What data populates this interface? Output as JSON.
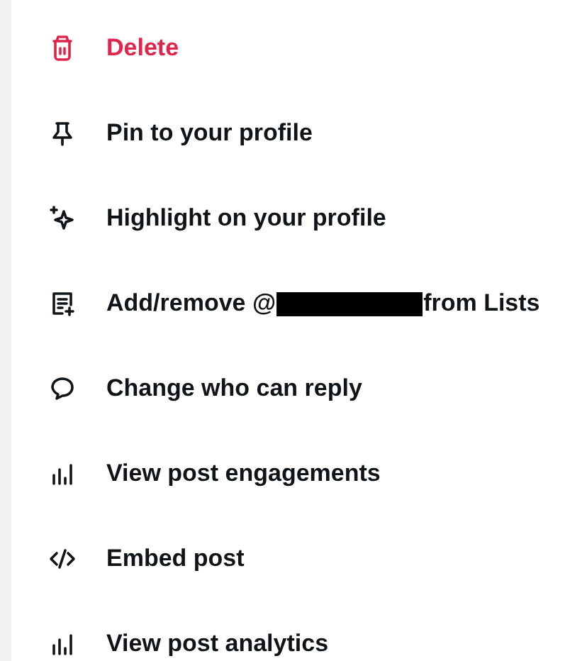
{
  "menu": {
    "items": [
      {
        "kind": "danger",
        "label": "Delete"
      },
      {
        "kind": "normal",
        "label": "Pin to your profile"
      },
      {
        "kind": "normal",
        "label": "Highlight on your profile"
      },
      {
        "kind": "redacted",
        "label": "Add/remove @",
        "label_after": "from Lists"
      },
      {
        "kind": "normal",
        "label": "Change who can reply"
      },
      {
        "kind": "normal",
        "label": "View post engagements"
      },
      {
        "kind": "normal",
        "label": "Embed post"
      },
      {
        "kind": "normal",
        "label": "View post analytics"
      }
    ]
  }
}
